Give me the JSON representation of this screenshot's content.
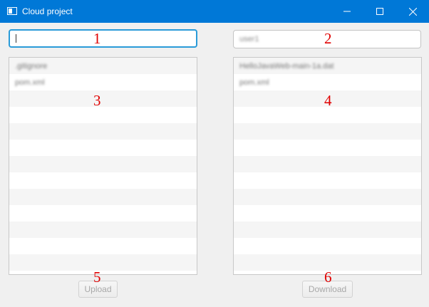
{
  "window": {
    "title": "Cloud project",
    "titlebar_color": "#0078d7",
    "controls": [
      "minimize-icon",
      "maximize-icon",
      "close-icon"
    ]
  },
  "left_panel": {
    "input": {
      "value": "",
      "focused": true
    },
    "items": [
      ".gitignore",
      "pom.xml"
    ],
    "button_label": "Upload",
    "button_enabled": false
  },
  "right_panel": {
    "input": {
      "value": "user1"
    },
    "items": [
      "HelloJavaWeb-main-1a.dat",
      "pom.xml"
    ],
    "button_label": "Download",
    "button_enabled": false
  },
  "markers": [
    "1",
    "2",
    "3",
    "4",
    "5",
    "6"
  ],
  "marker_color": "#e00000"
}
